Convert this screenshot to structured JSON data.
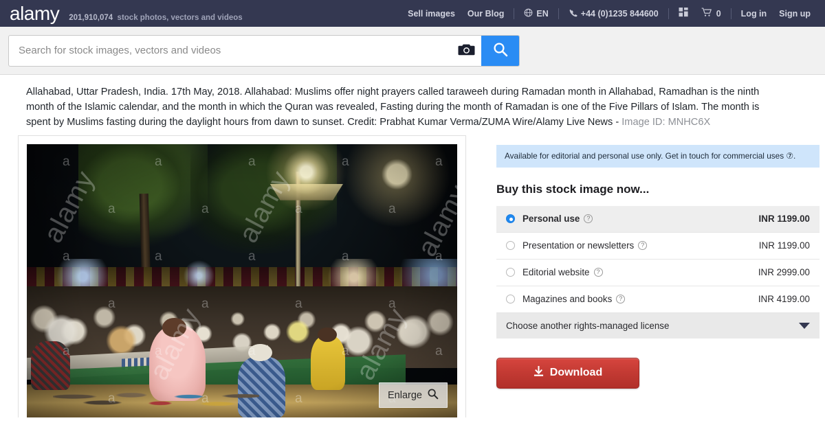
{
  "header": {
    "logo": "alamy",
    "count": "201,910,074",
    "tagline": "stock photos, vectors and videos",
    "nav": {
      "sell_images": "Sell images",
      "our_blog": "Our Blog",
      "language": "EN",
      "phone": "+44 (0)1235 844600",
      "cart_count": "0",
      "log_in": "Log in",
      "sign_up": "Sign up"
    },
    "brand_color": "#343851"
  },
  "search": {
    "placeholder": "Search for stock images, vectors and videos",
    "value": "",
    "button_color": "#2a8cf4"
  },
  "description": {
    "text": "Allahabad, Uttar Pradesh, India. 17th May, 2018. Allahabad: Muslims offer night prayers called taraweeh during Ramadan month in Allahabad, Ramadhan is the ninth month of the Islamic calendar, and the month in which the Quran was revealed, Fasting during the month of Ramadan is one of the Five Pillars of Islam. The month is spent by Muslims fasting during the daylight hours from dawn to sunset. Credit: Prabhat Kumar Verma/ZUMA Wire/Alamy Live News - ",
    "image_id": "Image ID: MNHC6X"
  },
  "image": {
    "watermark_text": "alamy",
    "watermark_letter": "a",
    "enlarge_label": "Enlarge"
  },
  "purchase": {
    "notice": "Available for editorial and personal use only. Get in touch for commercial uses ⑦.",
    "notice_color": "#cfe5fb",
    "title": "Buy this stock image now...",
    "options": [
      {
        "label": "Personal use",
        "price": "INR 1199.00",
        "selected": true
      },
      {
        "label": "Presentation or newsletters",
        "price": "INR 1199.00",
        "selected": false
      },
      {
        "label": "Editorial website",
        "price": "INR 2999.00",
        "selected": false
      },
      {
        "label": "Magazines and books",
        "price": "INR 4199.00",
        "selected": false
      }
    ],
    "rights_managed_label": "Choose another rights-managed license",
    "download_label": "Download",
    "download_color": "#c33a33"
  }
}
